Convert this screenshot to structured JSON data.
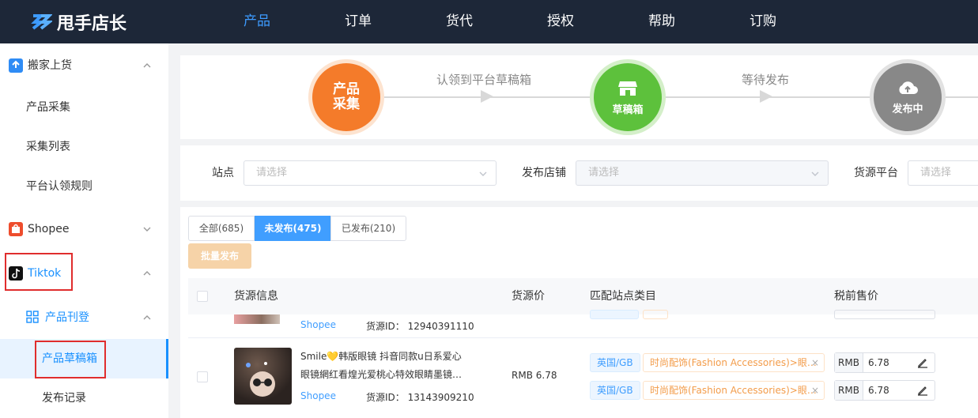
{
  "app": {
    "logo_text": "甩手店长"
  },
  "nav": [
    {
      "label": "产品",
      "active": true
    },
    {
      "label": "订单"
    },
    {
      "label": "货代"
    },
    {
      "label": "授权"
    },
    {
      "label": "帮助"
    },
    {
      "label": "订购"
    }
  ],
  "sidebar": {
    "group_move": "搬家上货",
    "item_collect": "产品采集",
    "item_collect_list": "采集列表",
    "item_claim_rules": "平台认领规则",
    "group_shopee": "Shopee",
    "group_tiktok": "Tiktok",
    "sub_group_listing": "产品刊登",
    "item_drafts": "产品草稿箱",
    "item_publish_records": "发布记录"
  },
  "steps": {
    "step1": "产品采集",
    "step1_line1": "产品",
    "step1_line2": "采集",
    "arrow1": "认领到平台草稿箱",
    "step2": "草稿箱",
    "arrow2": "等待发布",
    "step3": "发布中"
  },
  "filters": {
    "site_label": "站点",
    "site_placeholder": "请选择",
    "shop_label": "发布店铺",
    "shop_placeholder": "请选择",
    "source_label": "货源平台",
    "source_placeholder": "请选择"
  },
  "tabs": [
    {
      "label": "全部(685)"
    },
    {
      "label": "未发布(475)",
      "active": true
    },
    {
      "label": "已发布(210)"
    }
  ],
  "batch_button": "批量发布",
  "table": {
    "col_source": "货源信息",
    "col_price": "货源价",
    "col_category": "匹配站点类目",
    "col_pretax": "税前售价"
  },
  "rows": [
    {
      "platform": "Shopee",
      "source_id": "货源ID： 12940391110"
    },
    {
      "title_line1": "Smile💛韩版眼镜 抖音同款u日系爱心",
      "title_line2": "眼镜網红看煌光爱桃心特效眼睛墨镜…",
      "platform": "Shopee",
      "source_id": "货源ID： 13143909210",
      "price": "RMB 6.78",
      "sites": [
        {
          "site": "英国/GB",
          "category": "时尚配饰(Fashion Accessories)>眼…",
          "currency": "RMB",
          "value": "6.78"
        },
        {
          "site": "英国/GB",
          "category": "时尚配饰(Fashion Accessories)>眼…",
          "currency": "RMB",
          "value": "6.78"
        }
      ]
    }
  ],
  "colors": {
    "header_bg": "#1d2738",
    "accent": "#409eff",
    "step1": "#f47b2a",
    "step2": "#5dc13c",
    "step3": "#888888"
  }
}
